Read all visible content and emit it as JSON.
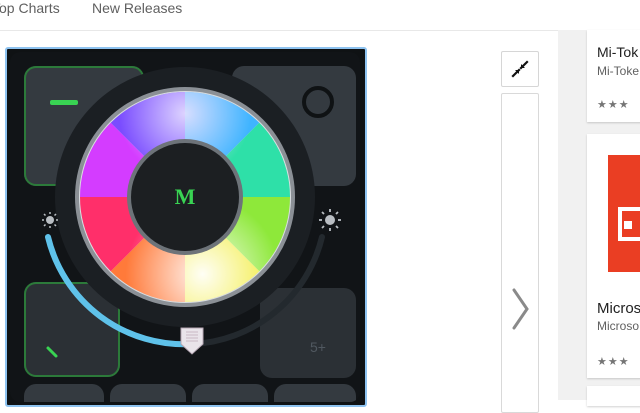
{
  "nav": {
    "tabs": [
      "Top Charts",
      "New Releases"
    ]
  },
  "screenshot": {
    "center_label": "M",
    "colors": {
      "frame_border": "#8ec3f0",
      "accent_green": "#39d353",
      "slider_blue": "#5fc2ea"
    }
  },
  "controls": {
    "collapse_icon": "collapse-arrows-icon",
    "next_icon": "chevron-right-icon"
  },
  "related_apps": [
    {
      "title": "Mi-Tok",
      "developer": "Mi-Toke",
      "stars": "★★★"
    },
    {
      "title": "Micros",
      "developer": "Microso",
      "stars": "★★★"
    }
  ]
}
